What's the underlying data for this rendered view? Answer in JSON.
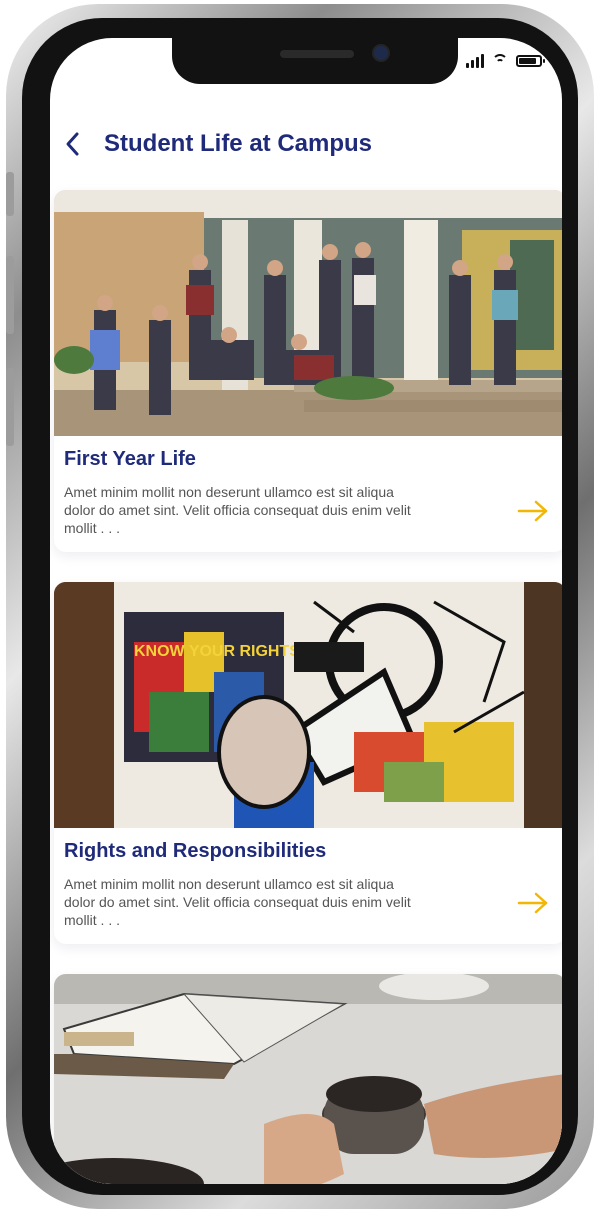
{
  "header": {
    "title": "Student Life at Campus",
    "back_icon": "chevron-left-icon"
  },
  "cards": [
    {
      "title": "First Year Life",
      "description": "Amet minim mollit non deserunt ullamco est sit aliqua dolor do amet sint. Velit officia consequat duis enim velit mollit . . .",
      "image": "students-on-campus-steps-photo",
      "arrow_icon": "arrow-right-icon"
    },
    {
      "title": "Rights and Responsibilities",
      "description": "Amet minim mollit non deserunt ullamco est sit aliqua dolor do amet sint. Velit officia consequat duis enim velit mollit . . .",
      "image": "graffiti-mural-photo",
      "mural_text": "KNOW YOUR RIGHTS",
      "arrow_icon": "arrow-right-icon"
    },
    {
      "image": "book-and-coffee-cup-photo"
    }
  ],
  "colors": {
    "title": "#1f2b7a",
    "accent_arrow": "#f2b705",
    "body_text": "#555555",
    "background": "#ffffff"
  }
}
